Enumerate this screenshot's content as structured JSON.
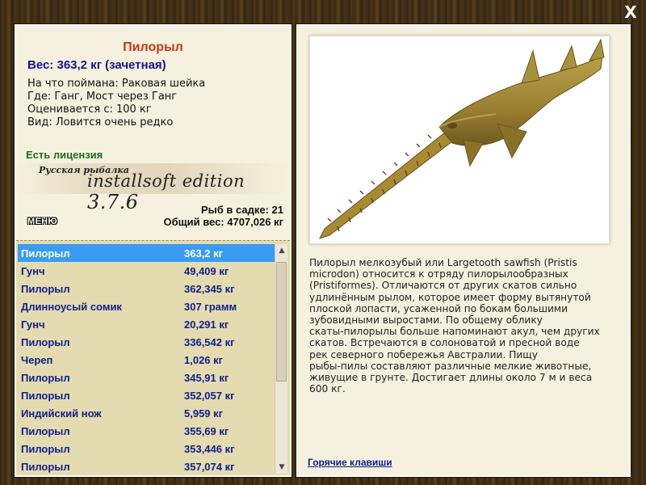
{
  "window": {
    "close_label": "X"
  },
  "fish": {
    "title": "Пилорыл",
    "weight_line": "Вес: 363,2 кг (зачетная)",
    "bait_line": "На что поймана: Раковая шейка",
    "location_line": "Где: Ганг, Мост через Ганг",
    "valued_line": "Оценивается с: 100 кг",
    "rarity_line": "Вид: Ловится очень редко",
    "license_line": "Есть лицензия"
  },
  "banner": {
    "small": "Русская рыбалка",
    "edition": "installsoft edition",
    "version": "3.7.6"
  },
  "stats": {
    "fish_in_cage": "Рыб в садке: 21",
    "total_weight": "Общий вес: 4707,026 кг"
  },
  "menu": {
    "label": "МЕНЮ"
  },
  "catch_list": [
    {
      "name": "Пилорыл",
      "weight": "363,2 кг",
      "selected": true
    },
    {
      "name": "Гунч",
      "weight": "49,409 кг",
      "selected": false
    },
    {
      "name": "Пилорыл",
      "weight": "362,345 кг",
      "selected": false
    },
    {
      "name": "Длинноусый сомик",
      "weight": "307 грамм",
      "selected": false
    },
    {
      "name": "Гунч",
      "weight": "20,291 кг",
      "selected": false
    },
    {
      "name": "Пилорыл",
      "weight": "336,542 кг",
      "selected": false
    },
    {
      "name": "Череп",
      "weight": "1,026 кг",
      "selected": false
    },
    {
      "name": "Пилорыл",
      "weight": "345,91 кг",
      "selected": false
    },
    {
      "name": "Пилорыл",
      "weight": "352,057 кг",
      "selected": false
    },
    {
      "name": "Индийский нож",
      "weight": "5,959 кг",
      "selected": false
    },
    {
      "name": "Пилорыл",
      "weight": "355,69 кг",
      "selected": false
    },
    {
      "name": "Пилорыл",
      "weight": "353,446 кг",
      "selected": false
    },
    {
      "name": "Пилорыл",
      "weight": "357,074 кг",
      "selected": false
    }
  ],
  "description": {
    "lines": [
      "Пилорыл мелкозубый или Largetooth sawfish (Pristis",
      "microdon) относится к отряду пилорылообразных",
      "(Pristiformes). Отличаются от других скатов сильно",
      "удлинённым рылом, которое имеет форму вытянутой",
      "плоской лопасти, усаженной по бокам большими",
      "зубовидными выростами. По общему облику",
      "скаты-пилорылы больше напоминают акул, чем других",
      "скатов. Встречаются в солоноватой и пресной воде",
      "рек северного побережья Австралии. Пищу",
      "рыбы-пилы составляют различные мелкие животные,",
      "живущие в грунте. Достигает длины около 7 м и веса",
      "600 кг."
    ]
  },
  "hotkeys": {
    "label": "Горячие клавиши"
  },
  "colors": {
    "title": "#c0391b",
    "weight": "#14148a",
    "license": "#1f6b1f",
    "list_text": "#0e1f8a",
    "selection": "#3a9bf2"
  }
}
